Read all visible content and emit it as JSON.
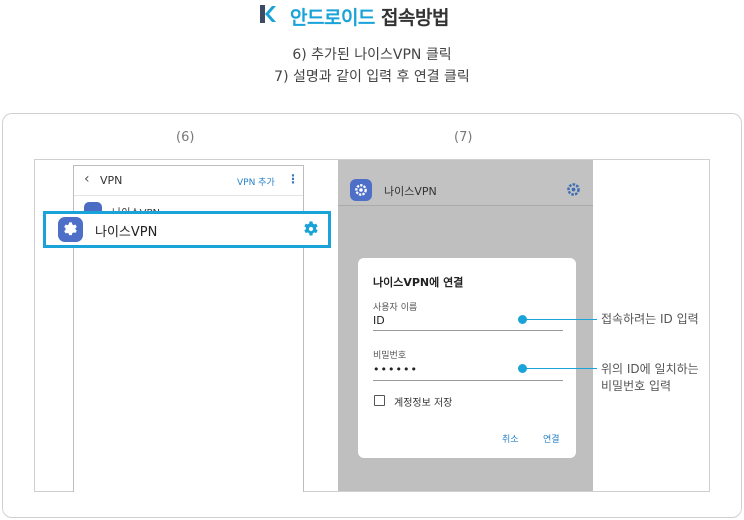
{
  "header": {
    "title_accent": "안드로이드",
    "title_rest": "접속방법",
    "brand_color": "#1aa3d8"
  },
  "steps": [
    "6) 추가된 나이스VPN 클릭",
    "7) 설명과 같이 입력 후 연결 클릭"
  ],
  "labels": {
    "step6": "(6)",
    "step7": "(7)"
  },
  "phone6": {
    "back_icon": "chevron-left-icon",
    "title": "VPN",
    "add_label": "VPN 추가",
    "more_icon": "more-vertical-icon",
    "row_label_behind": "나이스VPN",
    "highlight_label": "나이스VPN",
    "gear_icon": "gear-icon"
  },
  "phone7": {
    "vpn_label": "나이스VPN",
    "dialog": {
      "title": "나이스VPN에 연결",
      "username_label": "사용자 이름",
      "username_value": "ID",
      "password_label": "비밀번호",
      "password_value": "••••••",
      "save_label": "계정정보 저장",
      "cancel_label": "취소",
      "connect_label": "연결"
    }
  },
  "annotations": {
    "id": "접속하려는 ID 입력",
    "pw_line1": "위의 ID에 일치하는",
    "pw_line2": "비밀번호 입력"
  }
}
